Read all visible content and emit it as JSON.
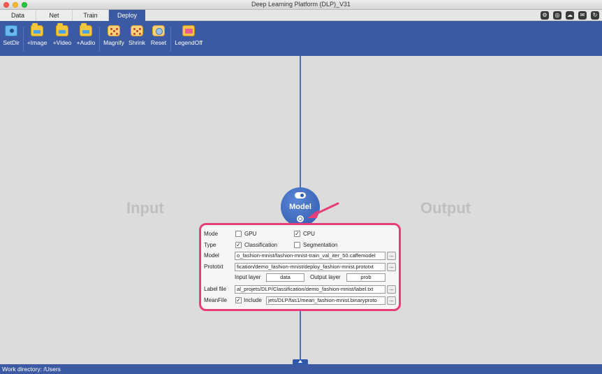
{
  "window": {
    "title": "Deep Learning Platform (DLP)_V31"
  },
  "tabs": [
    {
      "label": "Data"
    },
    {
      "label": "Net"
    },
    {
      "label": "Train"
    },
    {
      "label": "Deploy"
    }
  ],
  "header_icons": [
    "settings-icon",
    "compass-icon",
    "chat-icon",
    "mail-icon",
    "refresh-icon"
  ],
  "toolbar": {
    "setdir": "SetDir",
    "image": "+Image",
    "video": "+Video",
    "audio": "+Audio",
    "magnify": "Magnify",
    "shrink": "Shrink",
    "reset": "Reset",
    "legend": "LegendOff"
  },
  "canvas": {
    "input_label": "Input",
    "output_label": "Output",
    "model_label": "Model"
  },
  "panel": {
    "mode_label": "Mode",
    "gpu_label": "GPU",
    "gpu_checked": "",
    "cpu_label": "CPU",
    "cpu_checked": "✓",
    "type_label": "Type",
    "classification_label": "Classification",
    "classification_checked": "✓",
    "segmentation_label": "Segmentation",
    "segmentation_checked": "",
    "model_label": "Model",
    "model_value": "o_fashion-mnist/fashion-mnist-train_val_iter_50.caffemodel",
    "prototxt_label": "Prototxt",
    "prototxt_value": "fication/demo_fashion-mnist/deploy_fashion-mnist.prototxt",
    "input_layer_label": "Input layer",
    "input_layer_value": "data",
    "output_layer_label": "Output layer",
    "output_layer_value": "prob",
    "labelfile_label": "Label file",
    "labelfile_value": "al_projets/DLP/Classification/demo_fashion-mnist/label.txt",
    "meanfile_label": "MeanFile",
    "include_label": "Include",
    "include_checked": "✓",
    "meanfile_value": "jets/DLP/fas1/mean_fashion-mnist.binaryproto",
    "browse_label": "..."
  },
  "status": {
    "text": "Work directory: /Users"
  },
  "colors": {
    "accent": "#3b5aa3",
    "highlight": "#e63e7a",
    "canvas": "#dcdcdc"
  }
}
